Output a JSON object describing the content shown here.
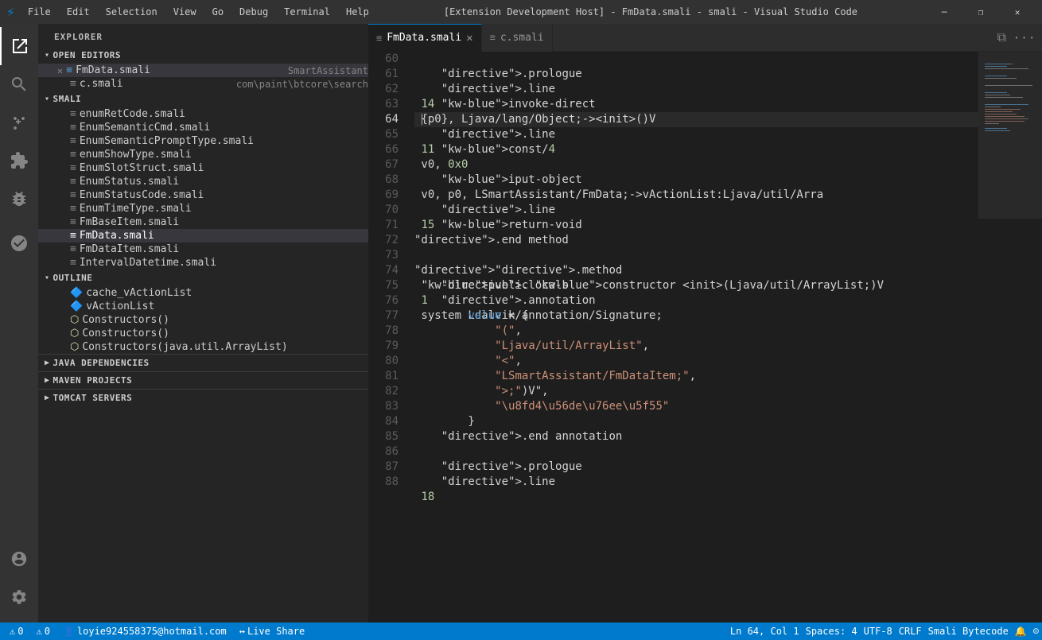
{
  "titlebar": {
    "icon": "⚡",
    "menu": [
      "File",
      "Edit",
      "Selection",
      "View",
      "Go",
      "Debug",
      "Terminal",
      "Help"
    ],
    "title": "[Extension Development Host] - FmData.smali - smali - Visual Studio Code",
    "controls": [
      "─",
      "❐",
      "✕"
    ]
  },
  "activity_bar": {
    "icons": [
      {
        "name": "explorer-icon",
        "symbol": "⎘",
        "active": true
      },
      {
        "name": "search-icon",
        "symbol": "🔍",
        "active": false
      },
      {
        "name": "source-control-icon",
        "symbol": "⑂",
        "active": false
      },
      {
        "name": "extensions-icon",
        "symbol": "⊞",
        "active": false
      },
      {
        "name": "debug-icon",
        "symbol": "🐛",
        "active": false
      },
      {
        "name": "remote-icon",
        "symbol": "⚗",
        "active": false
      }
    ],
    "bottom_icons": [
      {
        "name": "accounts-icon",
        "symbol": "👤"
      },
      {
        "name": "settings-icon",
        "symbol": "⚙"
      }
    ]
  },
  "sidebar": {
    "header": "EXPLORER",
    "open_editors": {
      "label": "OPEN EDITORS",
      "items": [
        {
          "name": "FmData.smali",
          "path": "SmartAssistant",
          "active": true,
          "has_close": true,
          "icon": "≡",
          "close_icon": "✕"
        },
        {
          "name": "c.smali",
          "path": "com\\paint\\btcore\\search",
          "active": false,
          "has_close": false,
          "icon": "≡",
          "close_icon": ""
        }
      ]
    },
    "smali": {
      "label": "SMALI",
      "files": [
        "enumRetCode.smali",
        "EnumSemanticCmd.smali",
        "EnumSemanticPromptType.smali",
        "enumShowType.smali",
        "EnumSlotStruct.smali",
        "EnumStatus.smali",
        "EnumStatusCode.smali",
        "EnumTimeType.smali",
        "FmBaseItem.smali",
        "FmData.smali",
        "FmDataItem.smali",
        "IntervalDatetime.smali"
      ]
    },
    "outline": {
      "label": "OUTLINE",
      "items": [
        {
          "icon": "🔷",
          "label": "cache_vActionList"
        },
        {
          "icon": "🔷",
          "label": "vActionList"
        },
        {
          "icon": "⬡",
          "label": "Constructors()"
        },
        {
          "icon": "⬡",
          "label": "Constructors()"
        },
        {
          "icon": "⬡",
          "label": "Constructors(java.util.ArrayList)"
        }
      ]
    },
    "java_deps": {
      "label": "JAVA DEPENDENCIES"
    },
    "maven": {
      "label": "MAVEN PROJECTS"
    },
    "tomcat": {
      "label": "TOMCAT SERVERS"
    }
  },
  "tabs": [
    {
      "label": "FmData.smali",
      "active": true,
      "modified": false,
      "icon": "≡"
    },
    {
      "label": "c.smali",
      "active": false,
      "modified": false,
      "icon": "≡"
    }
  ],
  "editor": {
    "lines": [
      {
        "num": 60,
        "content": "",
        "type": "blank"
      },
      {
        "num": 61,
        "content": "    .prologue",
        "type": "code"
      },
      {
        "num": 62,
        "content": "    .line 14",
        "type": "code"
      },
      {
        "num": 63,
        "content": "    invoke-direct {p0}, Ljava/lang/Object;-><init>()V",
        "type": "code"
      },
      {
        "num": 64,
        "content": "",
        "type": "cursor"
      },
      {
        "num": 65,
        "content": "    .line 11",
        "type": "code"
      },
      {
        "num": 66,
        "content": "    const/4 v0, 0x0",
        "type": "code"
      },
      {
        "num": 67,
        "content": "",
        "type": "blank"
      },
      {
        "num": 68,
        "content": "    iput-object v0, p0, LSmartAssistant/FmData;->vActionList:Ljava/util/Arra",
        "type": "code"
      },
      {
        "num": 69,
        "content": "",
        "type": "blank"
      },
      {
        "num": 70,
        "content": "    .line 15",
        "type": "code"
      },
      {
        "num": 71,
        "content": "    return-void",
        "type": "code"
      },
      {
        "num": 72,
        "content": ".end method",
        "type": "code"
      },
      {
        "num": 73,
        "content": "",
        "type": "blank"
      },
      {
        "num": 74,
        "content": ".method public constructor <init>(Ljava/util/ArrayList;)V",
        "type": "code"
      },
      {
        "num": 75,
        "content": "    .locals 1",
        "type": "code"
      },
      {
        "num": 76,
        "content": "    .annotation system Ldalvik/annotation/Signature;",
        "type": "code"
      },
      {
        "num": 77,
        "content": "        value = {",
        "type": "code"
      },
      {
        "num": 78,
        "content": "            \"(\",",
        "type": "code"
      },
      {
        "num": 79,
        "content": "            \"Ljava/util/ArrayList\",",
        "type": "code"
      },
      {
        "num": 80,
        "content": "            \"<\",",
        "type": "code"
      },
      {
        "num": 81,
        "content": "            \"LSmartAssistant/FmDataItem;\",",
        "type": "code"
      },
      {
        "num": 82,
        "content": "            \">;\")V\",",
        "type": "code"
      },
      {
        "num": 83,
        "content": "            \"\\u8fd4\\u56de\\u76ee\\u5f55\"",
        "type": "code"
      },
      {
        "num": 84,
        "content": "        }",
        "type": "code"
      },
      {
        "num": 85,
        "content": "    .end annotation",
        "type": "code"
      },
      {
        "num": 86,
        "content": "",
        "type": "blank"
      },
      {
        "num": 87,
        "content": "    .prologue",
        "type": "code"
      },
      {
        "num": 88,
        "content": "    .line 18",
        "type": "code"
      }
    ]
  },
  "status_bar": {
    "left": [
      {
        "icon": "⚠",
        "count": "0",
        "name": "errors"
      },
      {
        "icon": "⚠",
        "count": "0",
        "name": "warnings"
      },
      {
        "name": "email",
        "text": "loyie924558375@hotmail.com"
      },
      {
        "name": "liveshare",
        "icon": "↔",
        "text": "Live Share"
      }
    ],
    "right": [
      {
        "name": "position",
        "text": "Ln 64, Col 1"
      },
      {
        "name": "spaces",
        "text": "Spaces: 4"
      },
      {
        "name": "encoding",
        "text": "UTF-8"
      },
      {
        "name": "line-ending",
        "text": "CRLF"
      },
      {
        "name": "language",
        "text": "Smali Bytecode"
      },
      {
        "name": "notifications",
        "icon": "🔔"
      },
      {
        "name": "feedback",
        "icon": "☺"
      }
    ]
  }
}
